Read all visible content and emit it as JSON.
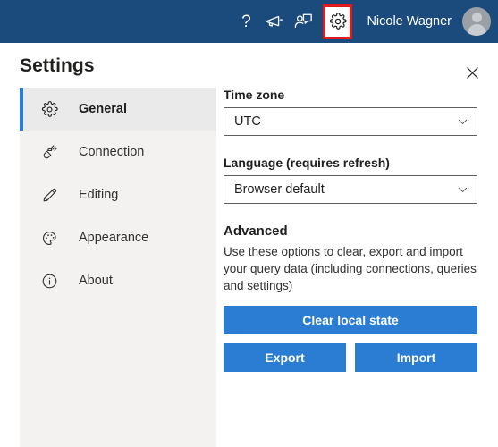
{
  "topbar": {
    "background_color": "#1a4b7c",
    "icons": [
      {
        "name": "help-icon",
        "glyph": "?"
      },
      {
        "name": "megaphone-icon",
        "glyph": "megaphone"
      },
      {
        "name": "feedback-icon",
        "glyph": "person-chat"
      }
    ],
    "settings_icon": {
      "name": "gear-icon",
      "highlighted": true,
      "highlight_color": "#e01b1b"
    },
    "user_name": "Nicole Wagner",
    "avatar": "user-avatar"
  },
  "panel": {
    "title": "Settings",
    "close_label": "Close"
  },
  "sidebar": {
    "background_color": "#f3f2f1",
    "accent_color": "#2b7cd3",
    "items": [
      {
        "label": "General",
        "icon": "gear-icon",
        "selected": true
      },
      {
        "label": "Connection",
        "icon": "plug-icon",
        "selected": false
      },
      {
        "label": "Editing",
        "icon": "pencil-icon",
        "selected": false
      },
      {
        "label": "Appearance",
        "icon": "palette-icon",
        "selected": false
      },
      {
        "label": "About",
        "icon": "info-icon",
        "selected": false
      }
    ]
  },
  "content": {
    "timezone": {
      "label": "Time zone",
      "value": "UTC",
      "options": [
        "UTC"
      ]
    },
    "language": {
      "label": "Language (requires refresh)",
      "value": "Browser default",
      "options": [
        "Browser default"
      ]
    },
    "advanced": {
      "title": "Advanced",
      "description": "Use these options to clear, export and import your query data (including connections, queries and settings)",
      "clear_button": "Clear local state",
      "export_button": "Export",
      "import_button": "Import",
      "button_color": "#2b7cd3"
    }
  }
}
